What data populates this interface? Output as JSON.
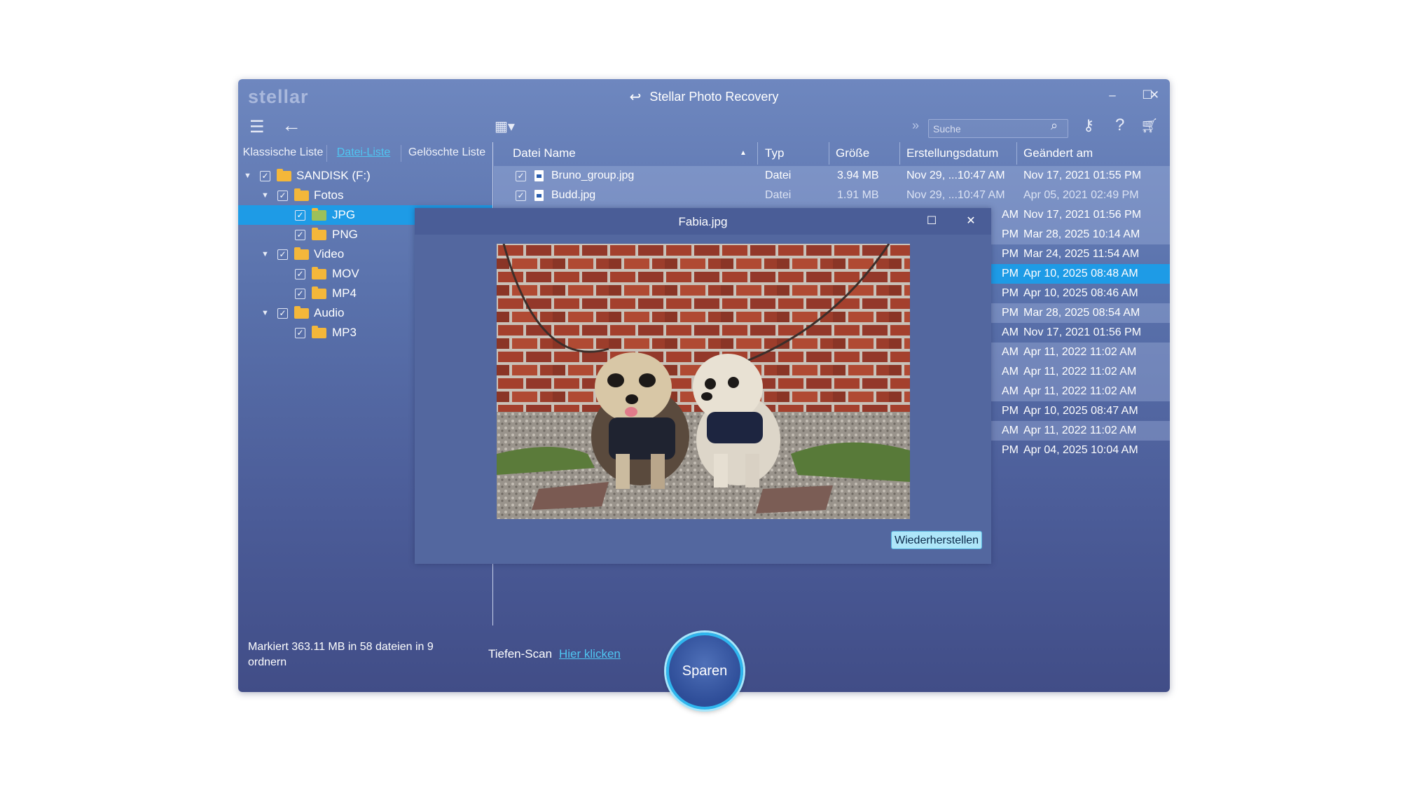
{
  "app": {
    "logo": "stellar",
    "title": "Stellar Photo Recovery",
    "window_controls": [
      "–",
      "☐",
      "✕"
    ]
  },
  "toolbar": {
    "icons": [
      "menu-icon",
      "back-arrow-icon",
      "view-grid-icon",
      "double-chevron-icon",
      "search-icon",
      "key-icon",
      "help-icon",
      "cart-icon"
    ],
    "search_placeholder": "Suche"
  },
  "tabs": [
    "Klassische Liste",
    "Datei-Liste",
    "Gelöschte Liste"
  ],
  "active_tab": "Datei-Liste",
  "tree": [
    {
      "label": "SANDISK (F:)",
      "level": 0,
      "expanded": true,
      "checked": true
    },
    {
      "label": "Fotos",
      "level": 1,
      "expanded": true,
      "checked": true
    },
    {
      "label": "JPG",
      "level": 2,
      "checked": true,
      "selected": true
    },
    {
      "label": "PNG",
      "level": 2,
      "checked": true
    },
    {
      "label": "Video",
      "level": 1,
      "expanded": true,
      "checked": true
    },
    {
      "label": "MOV",
      "level": 2,
      "checked": true
    },
    {
      "label": "MP4",
      "level": 2,
      "checked": true
    },
    {
      "label": "Audio",
      "level": 1,
      "expanded": true,
      "checked": true
    },
    {
      "label": "MP3",
      "level": 2,
      "checked": true
    }
  ],
  "table": {
    "columns": [
      "Datei Name",
      "Typ",
      "Größe",
      "Erstellungsdatum",
      "Geändert am"
    ],
    "sort_indicator": "▲",
    "rows": [
      {
        "name": "Bruno_group.jpg",
        "type": "Datei",
        "size": "3.94 MB",
        "created": "Nov 29, ...10:47 AM",
        "modified": "Nov 17, 2021 01:55 PM"
      },
      {
        "name": "Budd.jpg",
        "type": "Datei",
        "size": "1.91 MB",
        "created": "Nov 29, ...10:47 AM",
        "modified": "Apr 05, 2021 02:49 PM"
      },
      {
        "created_tail": "AM",
        "modified": "Nov 17, 2021 01:56 PM"
      },
      {
        "created_tail": "PM",
        "modified": "Mar 28, 2025 10:14 AM"
      },
      {
        "created_tail": "PM",
        "modified": "Mar 24, 2025 11:54 AM"
      },
      {
        "created_tail": "PM",
        "modified": "Apr 10, 2025 08:48 AM",
        "highlight": true
      },
      {
        "created_tail": "PM",
        "modified": "Apr 10, 2025 08:46 AM"
      },
      {
        "created_tail": "PM",
        "modified": "Mar 28, 2025 08:54 AM"
      },
      {
        "created_tail": "AM",
        "modified": "Nov 17, 2021 01:56 PM"
      },
      {
        "created_tail": "AM",
        "modified": "Apr 11, 2022 11:02 AM"
      },
      {
        "created_tail": "AM",
        "modified": "Apr 11, 2022 11:02 AM"
      },
      {
        "created_tail": "AM",
        "modified": "Apr 11, 2022 11:02 AM"
      },
      {
        "created_tail": "PM",
        "modified": "Apr 10, 2025 08:47 AM"
      },
      {
        "created_tail": "AM",
        "modified": "Apr 11, 2022 11:02 AM"
      },
      {
        "created_tail": "PM",
        "modified": "Apr 04, 2025 10:04 AM"
      }
    ]
  },
  "preview": {
    "title": "Fabia.jpg",
    "restore_label": "Wiederherstellen"
  },
  "status": {
    "marked": "Markiert 363.11 MB in 58 dateien in 9 ordnern",
    "deep_scan_label": "Tiefen-Scan",
    "deep_scan_link": "Hier klicken"
  },
  "save_button": "Sparen",
  "colors": {
    "window_top": "#6e87bf",
    "window_bottom": "#414d87",
    "selection": "#1e9be6",
    "link": "#4fc6f2",
    "folder": "#f4b73a"
  }
}
